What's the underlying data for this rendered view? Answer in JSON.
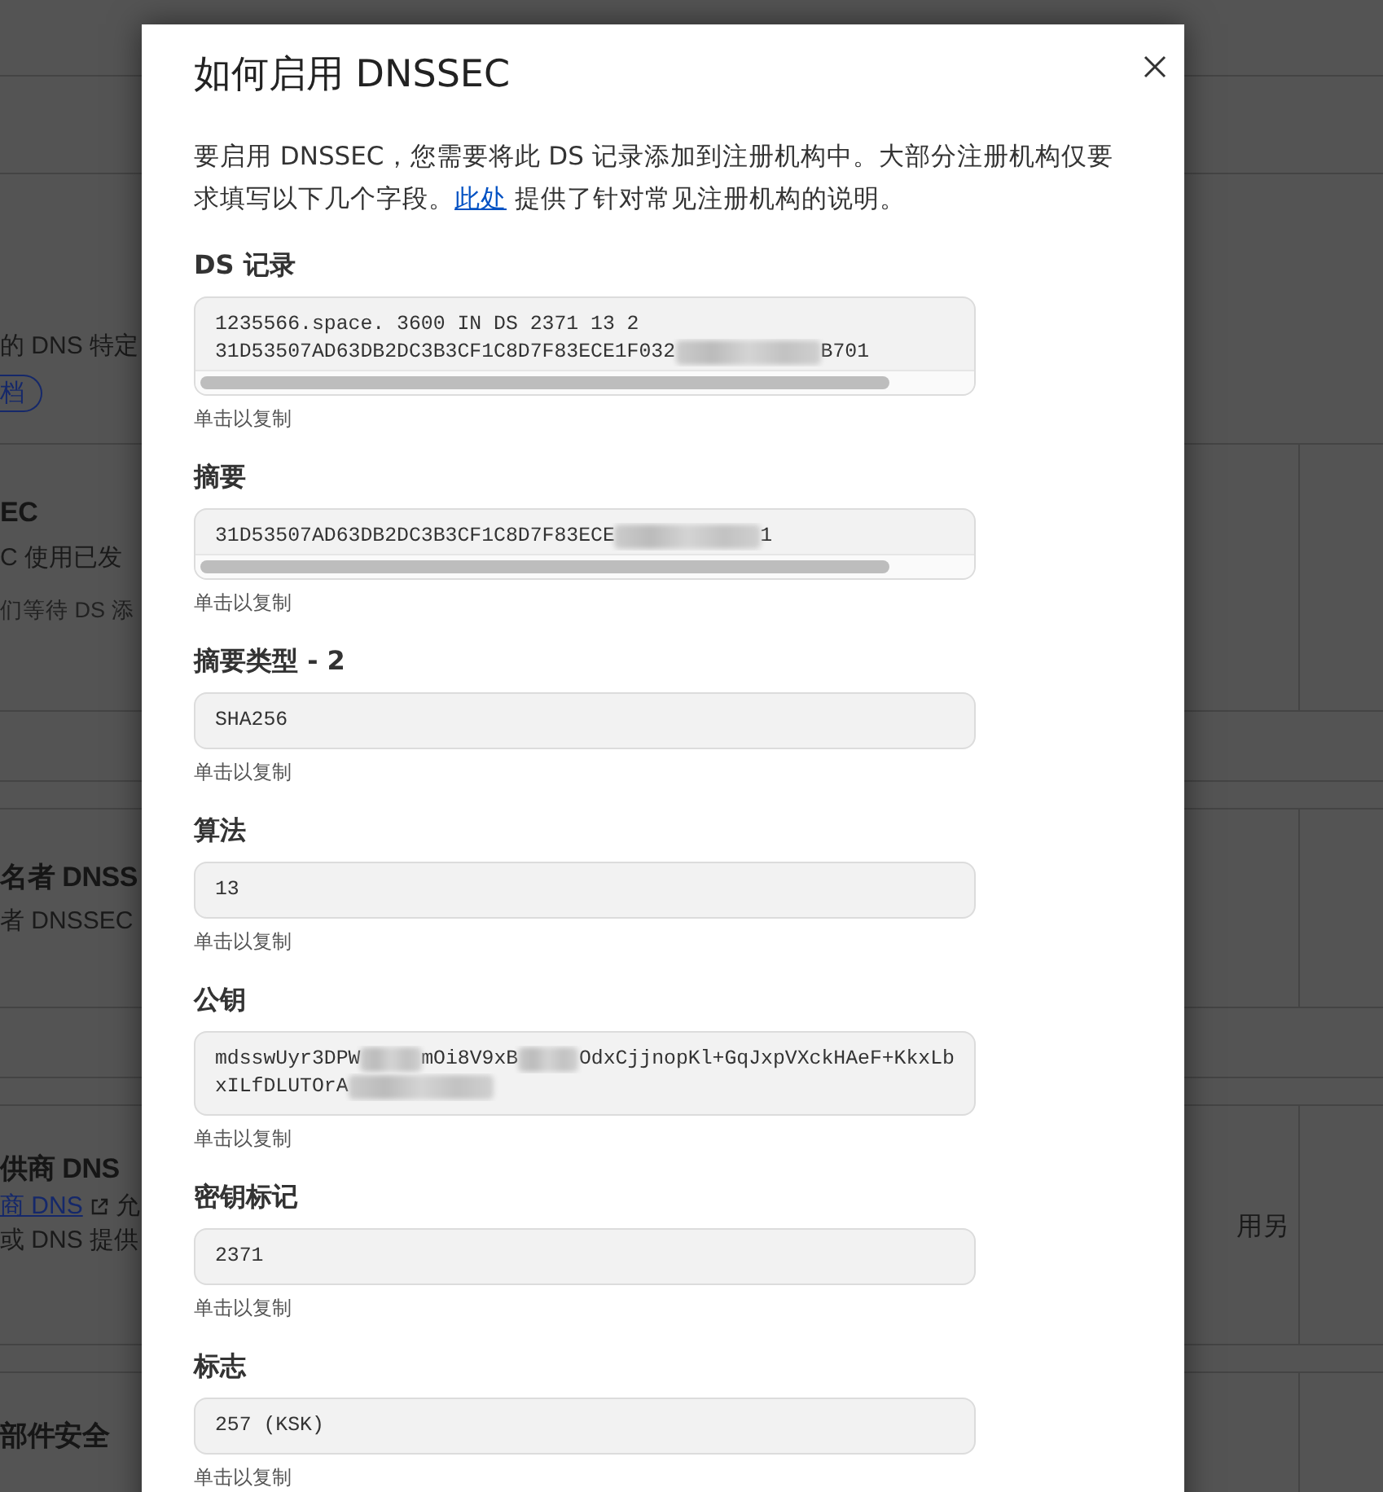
{
  "background_page": {
    "sections": [
      {
        "split": false,
        "items": [
          {
            "kind": "text",
            "text": "的 DNS 特定"
          },
          {
            "kind": "button",
            "text": "档"
          }
        ]
      },
      {
        "split": true,
        "items": [
          {
            "kind": "heading",
            "text": "EC"
          },
          {
            "kind": "text",
            "text": "C 使用已发"
          },
          {
            "kind": "note",
            "text": "们等待 DS 添"
          }
        ]
      },
      {
        "split": true,
        "items": [
          {
            "kind": "heading",
            "text": "名者 DNSS"
          },
          {
            "kind": "text",
            "text": "者 DNSSEC"
          }
        ]
      },
      {
        "split": true,
        "trailing_text": "用另",
        "items": [
          {
            "kind": "heading",
            "text": "供商 DNS"
          },
          {
            "kind": "link_line",
            "link": "商 DNS",
            "text": "允"
          },
          {
            "kind": "text",
            "text": "或 DNS 提供"
          }
        ]
      },
      {
        "split": true,
        "items": [
          {
            "kind": "heading",
            "text": "部件安全"
          }
        ]
      }
    ]
  },
  "dialog": {
    "title": "如何启用 DNSSEC",
    "intro_before": "要启用 DNSSEC，您需要将此 DS 记录添加到注册机构中。大部分注册机构仅要求填写以下几个字段。",
    "intro_link": "此处",
    "intro_after": " 提供了针对常见注册机构的说明。",
    "fields": [
      {
        "label": "DS 记录",
        "scrollable": true,
        "hint": "单击以复制",
        "lines": [
          [
            {
              "kind": "text",
              "text": "1235566.space. 3600 IN DS 2371 13 2"
            }
          ],
          [
            {
              "kind": "text",
              "text": "31D53507AD63DB2DC3B3CF1C8D7F83ECE1F032"
            },
            {
              "kind": "blur"
            },
            {
              "kind": "text",
              "text": "B701"
            }
          ]
        ]
      },
      {
        "label": "摘要",
        "scrollable": true,
        "hint": "单击以复制",
        "lines": [
          [
            {
              "kind": "text",
              "text": "31D53507AD63DB2DC3B3CF1C8D7F83ECE"
            },
            {
              "kind": "blur"
            },
            {
              "kind": "text",
              "text": "1"
            }
          ]
        ]
      },
      {
        "label": "摘要类型 - 2",
        "scrollable": false,
        "hint": "单击以复制",
        "lines": [
          [
            {
              "kind": "text",
              "text": "SHA256"
            }
          ]
        ]
      },
      {
        "label": "算法",
        "scrollable": false,
        "hint": "单击以复制",
        "lines": [
          [
            {
              "kind": "text",
              "text": "13"
            }
          ]
        ]
      },
      {
        "label": "公钥",
        "scrollable": false,
        "hint": "单击以复制",
        "lines": [
          [
            {
              "kind": "text",
              "text": "mdsswUyr3DPW"
            },
            {
              "kind": "blur"
            },
            {
              "kind": "text",
              "text": "mOi8V9xB"
            },
            {
              "kind": "blur"
            },
            {
              "kind": "text",
              "text": "OdxCjjnopKl+GqJxpVXckHAeF+KkxLb"
            }
          ],
          [
            {
              "kind": "text",
              "text": "xILfDLUTOrA"
            },
            {
              "kind": "blur"
            }
          ]
        ]
      },
      {
        "label": "密钥标记",
        "scrollable": false,
        "hint": "单击以复制",
        "lines": [
          [
            {
              "kind": "text",
              "text": "2371"
            }
          ]
        ]
      },
      {
        "label": "标志",
        "scrollable": false,
        "hint": "单击以复制",
        "lines": [
          [
            {
              "kind": "text",
              "text": "257 (KSK)"
            }
          ]
        ]
      }
    ]
  }
}
